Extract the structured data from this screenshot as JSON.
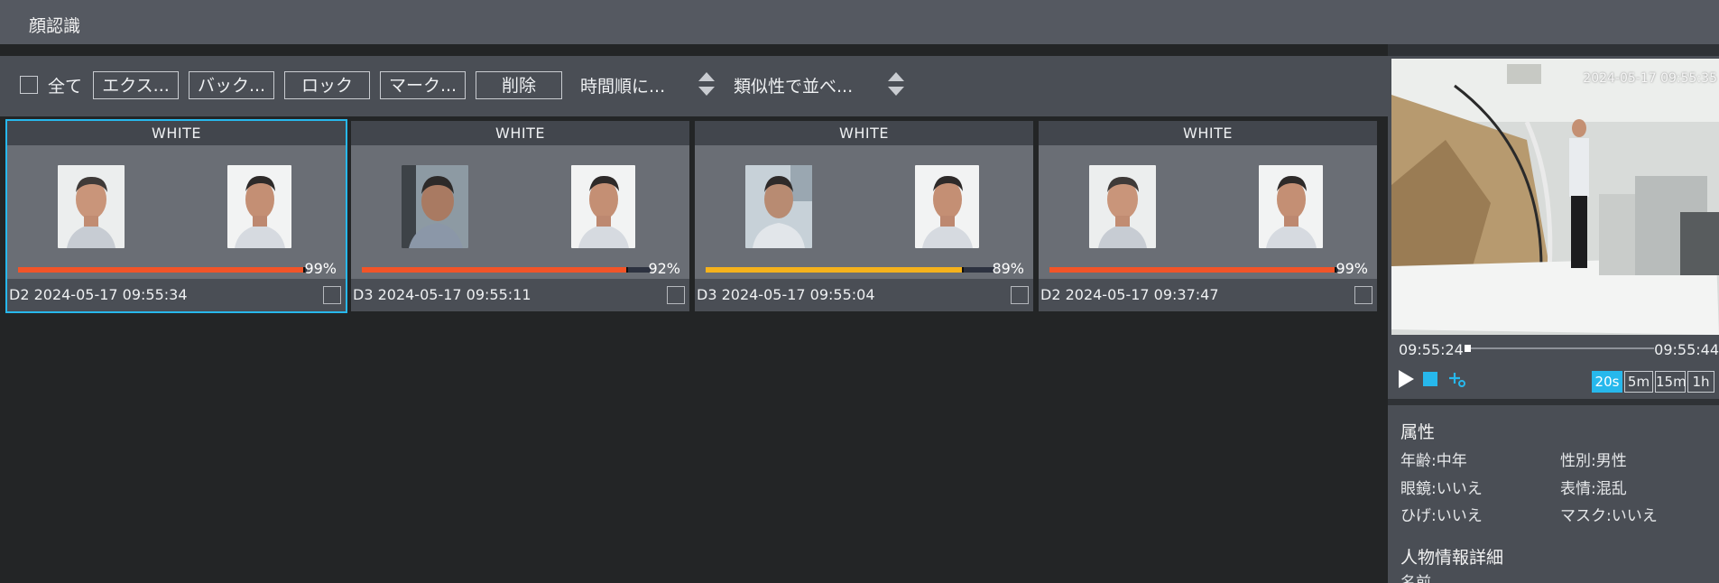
{
  "window": {
    "title": "顔認識"
  },
  "toolbar": {
    "select_all_label": "全て",
    "buttons": [
      "エクス...",
      "バック...",
      "ロック",
      "マーク...",
      "削除"
    ],
    "sort_time_label": "時間順に...",
    "sort_similarity_label": "類似性で並べ..."
  },
  "results": [
    {
      "list_label": "WHITE",
      "similarity_label": "99%",
      "similarity": 0.99,
      "bar_color": "#f25428",
      "channel_time": "D2 2024-05-17 09:55:34",
      "selected": true
    },
    {
      "list_label": "WHITE",
      "similarity_label": "92%",
      "similarity": 0.92,
      "bar_color": "#f25428",
      "channel_time": "D3 2024-05-17 09:55:11",
      "selected": false
    },
    {
      "list_label": "WHITE",
      "similarity_label": "89%",
      "similarity": 0.89,
      "bar_color": "#f5b21c",
      "channel_time": "D3 2024-05-17 09:55:04",
      "selected": false
    },
    {
      "list_label": "WHITE",
      "similarity_label": "99%",
      "similarity": 0.99,
      "bar_color": "#f25428",
      "channel_time": "D2 2024-05-17 09:37:47",
      "selected": false
    }
  ],
  "player": {
    "video_timestamp": "2024-05-17 09:55:35",
    "start_time": "09:55:24",
    "end_time": "09:55:44",
    "durations": [
      "20s",
      "5m",
      "15m",
      "1h"
    ],
    "active_duration": "20s",
    "accent_color": "#27b8ec"
  },
  "attributes": {
    "heading": "属性",
    "age": "年齢:中年",
    "gender": "性別:男性",
    "glasses": "眼鏡:いいえ",
    "expression": "表情:混乱",
    "beard": "ひげ:いいえ",
    "mask": "マスク:いいえ",
    "details_heading": "人物情報詳細",
    "details_first": "名前"
  }
}
